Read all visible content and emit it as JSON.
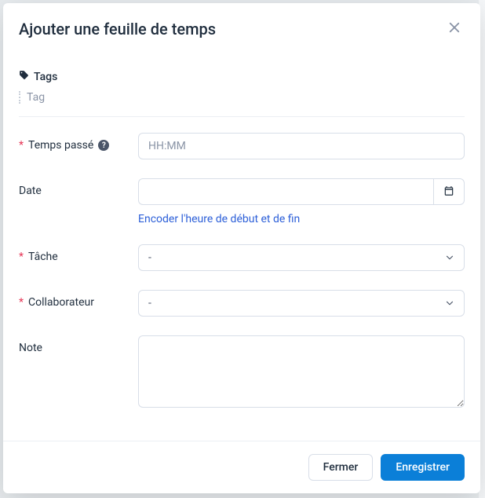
{
  "modal": {
    "title": "Ajouter une feuille de temps"
  },
  "tags": {
    "label": "Tags",
    "placeholder": "Tag"
  },
  "fields": {
    "time_spent": {
      "label": "Temps passé",
      "required": true,
      "placeholder": "HH:MM",
      "help": "?"
    },
    "date": {
      "label": "Date",
      "value": "",
      "encode_link": "Encoder l'heure de début et de fin"
    },
    "task": {
      "label": "Tâche",
      "required": true,
      "selected": "-"
    },
    "collaborator": {
      "label": "Collaborateur",
      "required": true,
      "selected": "-"
    },
    "note": {
      "label": "Note",
      "value": ""
    }
  },
  "footer": {
    "close": "Fermer",
    "save": "Enregistrer"
  }
}
